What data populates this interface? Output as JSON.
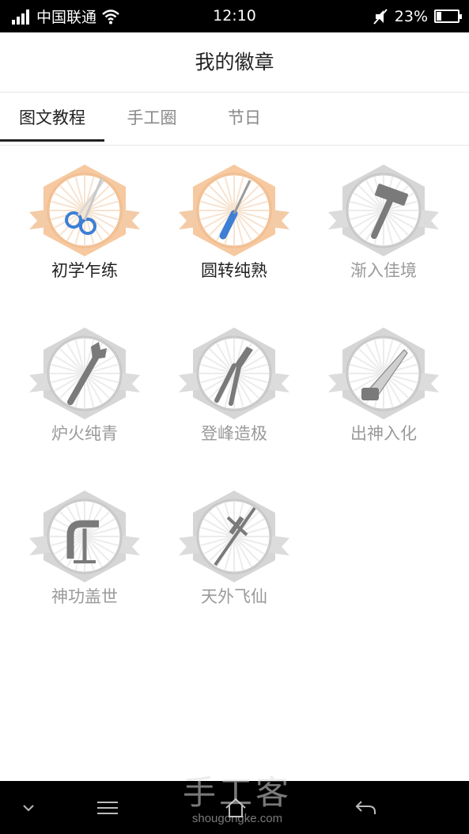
{
  "status_bar": {
    "carrier": "中国联通",
    "time": "12:10",
    "battery_pct": "23%",
    "battery_level": 0.23,
    "icons": [
      "signal-icon",
      "wifi-icon",
      "silent-icon",
      "battery-icon"
    ]
  },
  "header": {
    "title": "我的徽章"
  },
  "tabs": [
    {
      "label": "图文教程",
      "active": true
    },
    {
      "label": "手工圈",
      "active": false
    },
    {
      "label": "节日",
      "active": false
    }
  ],
  "badges": [
    {
      "label": "初学乍练",
      "icon": "scissors-icon",
      "earned": true
    },
    {
      "label": "圆转纯熟",
      "icon": "screwdriver-icon",
      "earned": true
    },
    {
      "label": "渐入佳境",
      "icon": "hammer-icon",
      "earned": false
    },
    {
      "label": "炉火纯青",
      "icon": "wrench-icon",
      "earned": false
    },
    {
      "label": "登峰造极",
      "icon": "pliers-icon",
      "earned": false
    },
    {
      "label": "出神入化",
      "icon": "saw-icon",
      "earned": false
    },
    {
      "label": "神功盖世",
      "icon": "clamp-icon",
      "earned": false
    },
    {
      "label": "天外飞仙",
      "icon": "caliper-icon",
      "earned": false
    }
  ],
  "nav_bar": {
    "buttons": [
      "chevron-down-icon",
      "menu-icon",
      "home-icon",
      "back-icon"
    ]
  },
  "watermark": {
    "main": "手工客",
    "sub": "shougongke.com"
  },
  "colors": {
    "earned_hex": "#f6c9a0",
    "earned_ribbon": "#f3cba6",
    "locked_hex": "#d6d6d6",
    "locked_ribbon": "#dcdcdc",
    "tool_blue": "#3d7fd4"
  }
}
